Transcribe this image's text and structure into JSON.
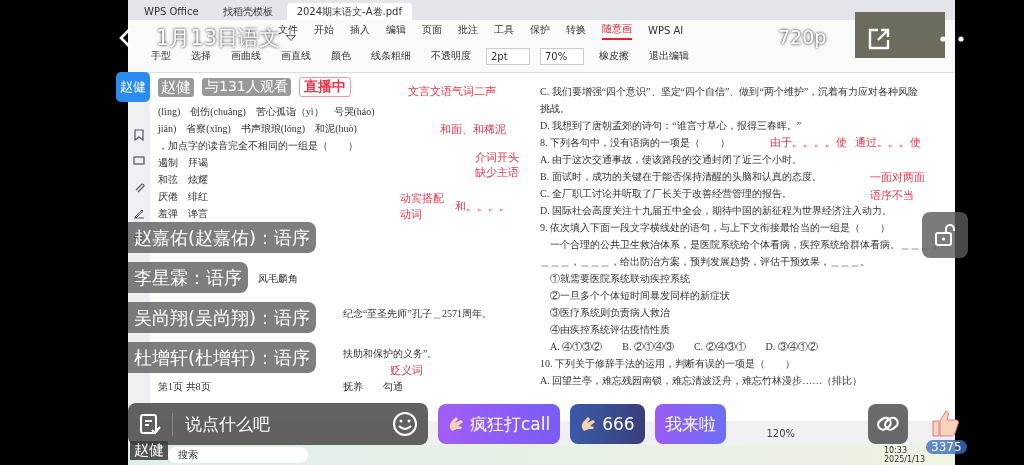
{
  "stream": {
    "title": "1月13日语文",
    "quality": "720p",
    "host_badge": "赵健",
    "host_name": "赵健",
    "viewers": "与131人观看",
    "live_badge": "直播中"
  },
  "shared_screen": {
    "tabs": [
      {
        "label": "WPS Office",
        "selected": false
      },
      {
        "label": "找稻壳模板",
        "selected": false
      },
      {
        "label": "2024期末语文-A卷.pdf",
        "selected": true
      }
    ],
    "menu": [
      {
        "label": "文件",
        "selected": false
      },
      {
        "label": "开始",
        "selected": false
      },
      {
        "label": "插入",
        "selected": false
      },
      {
        "label": "编辑",
        "selected": false
      },
      {
        "label": "页面",
        "selected": false
      },
      {
        "label": "批注",
        "selected": false
      },
      {
        "label": "工具",
        "selected": false
      },
      {
        "label": "保护",
        "selected": false
      },
      {
        "label": "转换",
        "selected": false
      },
      {
        "label": "随意画",
        "selected": true
      },
      {
        "label": "WPS AI",
        "selected": false
      }
    ],
    "toolbar": [
      {
        "label": "手型"
      },
      {
        "label": "选择"
      },
      {
        "label": "画曲线"
      },
      {
        "label": "画直线"
      },
      {
        "label": "颜色"
      },
      {
        "label": "线条粗细"
      },
      {
        "label": "不透明度"
      },
      {
        "label": "2pt"
      },
      {
        "label": "70%"
      },
      {
        "label": "橡皮擦"
      },
      {
        "label": "退出编辑"
      }
    ],
    "doc_left": [
      "(lìng)　创伤(chuāng)　苦心孤诣（yì）　号哭(háo)",
      "jiān)　省察(xǐng)　书声琅琅(lóng)　和泥(huò)",
      "，加点字的读音完全不相同的一组是（　　）",
      "遏制　拜谒",
      "和弦　炫耀",
      "厌倦　绯红",
      "羞弹　谗言"
    ],
    "doc_left_beside": [
      "凤毛麟角",
      "纪念“至圣先师”孔子＿2571周年。",
      "扶助和保护的义务”。",
      "抚养　　勾通"
    ],
    "doc_right": [
      "C. 我们要增强“四个意识”、坚定“四个自信”、做到“两个维护”，沉着有力应对各种风险",
      "挑战。",
      "D. 我想到了唐朝孟郊的诗句：“谁言寸草心，报得三春晖。”",
      "8. 下列各句中，没有语病的一项是（　　）",
      "A. 由于这次交通事故，使该路段的交通封闭了近三个小时。",
      "B. 面试时，成功的关键在于能否保持清醒的头脑和认真的态度。",
      "C. 全厂职工讨论并听取了厂长关于改善经营管理的报告。",
      "D. 国际社会高度关注十九届五中全会，期待中国的新征程为世界经济注入动力。",
      "9. 依次填入下面一段文字横线处的语句，与上下文衔接最恰当的一组是（　　）",
      "　一个合理的公共卫生救治体系，是医院系统给个体看病，疾控系统给群体看病。＿＿＿，",
      "＿＿＿，＿＿＿，给出防治方案，预判发展趋势，评估干预效果，＿＿＿。",
      "　①就需要医院系统联动疾控系统",
      "　②一旦多个个体短时间暴发同样的新症状",
      "　③医疗系统则负责病人救治",
      "　④由疾控系统评估疫情性质",
      "　A. ④①③②　　B. ②①④③　　C. ②④③①　　D. ③④①②",
      "10. 下列关于修辞手法的运用，判断有误的一项是（　　）",
      "A. 回望兰亭，难忘残园南锁，难忘清波泛舟，难忘竹林漫步……（排比）"
    ],
    "annotations": [
      {
        "text": "文言文语气词二声"
      },
      {
        "text": "和面、和稀泥"
      },
      {
        "text": "动宾搭配"
      },
      {
        "text": "和。。。。"
      },
      {
        "text": "动词"
      },
      {
        "text": "介词开头"
      },
      {
        "text": "缺少主语"
      },
      {
        "text": "由于。。。。使"
      },
      {
        "text": "通过。。。使"
      },
      {
        "text": "一面对两面"
      },
      {
        "text": "语序不当"
      },
      {
        "text": "贬义词"
      }
    ],
    "page_footer": "第1页 共8页",
    "zoom": "120%",
    "taskbar_search": "搜索",
    "clock_time": "10:33",
    "clock_date": "2025/1/13"
  },
  "comments": [
    {
      "text": "赵嘉佑(赵嘉佑)：语序"
    },
    {
      "text": "李星霖：语序"
    },
    {
      "text": "吴尚翔(吴尚翔)：语序"
    },
    {
      "text": "杜增轩(杜增轩)：语序"
    }
  ],
  "composer": {
    "placeholder": "说点什么吧"
  },
  "quick_replies": [
    {
      "kind": "call",
      "label": "疯狂打call"
    },
    {
      "kind": "six",
      "label": "666"
    },
    {
      "kind": "come",
      "label": "我来啦"
    }
  ],
  "likes": "3375",
  "presenter_label": "赵健"
}
